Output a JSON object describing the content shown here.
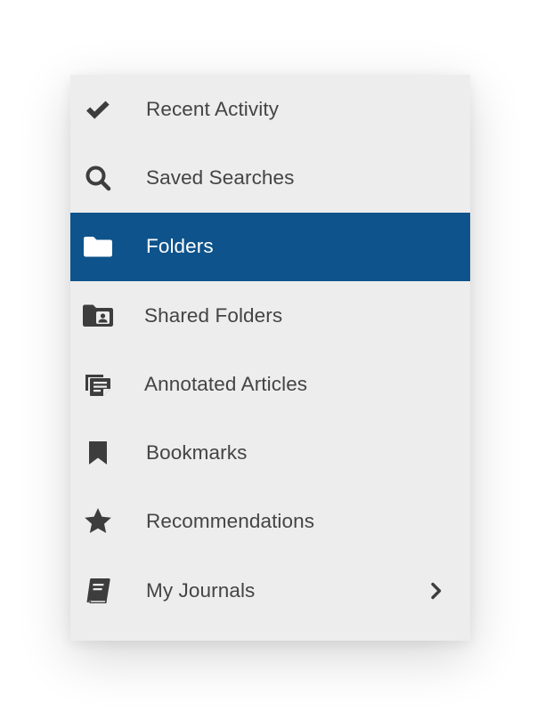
{
  "menu": {
    "items": [
      {
        "label": "Recent Activity",
        "icon": "checkmark-icon",
        "selected": false
      },
      {
        "label": "Saved Searches",
        "icon": "search-icon",
        "selected": false
      },
      {
        "label": "Folders",
        "icon": "folder-icon",
        "selected": true
      },
      {
        "label": "Shared Folders",
        "icon": "shared-folder-icon",
        "selected": false
      },
      {
        "label": "Annotated Articles",
        "icon": "annotated-notes-icon",
        "selected": false
      },
      {
        "label": "Bookmarks",
        "icon": "bookmark-icon",
        "selected": false
      },
      {
        "label": "Recommendations",
        "icon": "star-icon",
        "selected": false
      },
      {
        "label": "My Journals",
        "icon": "journal-book-icon",
        "selected": false,
        "has_submenu": true,
        "submenu_icon": "chevron-right-icon"
      }
    ]
  },
  "colors": {
    "panel_background": "#ededed",
    "selected_background": "#0e538b",
    "selected_text": "#ffffff",
    "text": "#444444",
    "icon": "#3d3d3d"
  }
}
